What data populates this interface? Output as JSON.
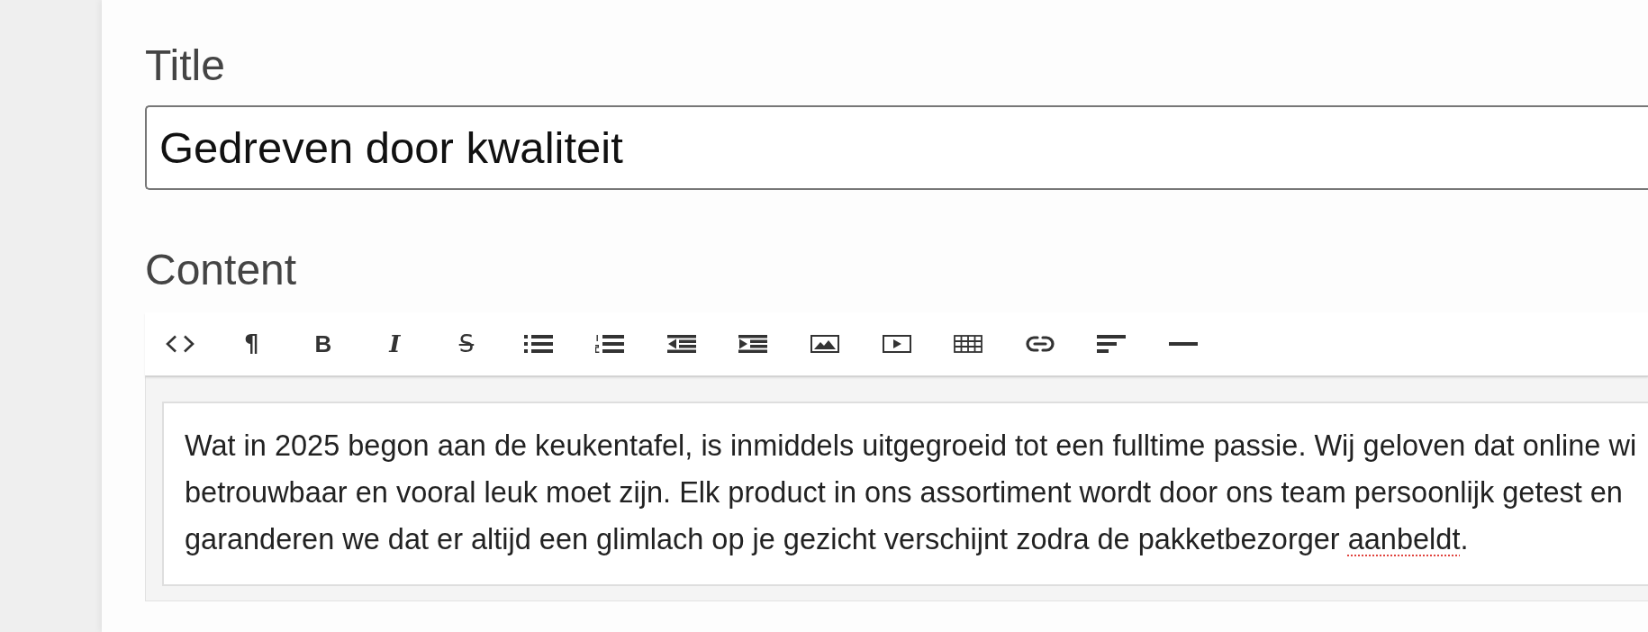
{
  "title_field": {
    "label": "Title",
    "value": "Gedreven door kwaliteit"
  },
  "content_editor": {
    "label": "Content",
    "toolbar": [
      {
        "kind": "source"
      },
      {
        "kind": "paragraph",
        "glyph": "¶"
      },
      {
        "kind": "bold",
        "glyph": "B"
      },
      {
        "kind": "italic",
        "glyph": "I"
      },
      {
        "kind": "strikethrough",
        "glyph": "S"
      },
      {
        "kind": "bullet-list"
      },
      {
        "kind": "numbered-list"
      },
      {
        "kind": "outdent"
      },
      {
        "kind": "indent"
      },
      {
        "kind": "image"
      },
      {
        "kind": "video"
      },
      {
        "kind": "table"
      },
      {
        "kind": "link"
      },
      {
        "kind": "align"
      },
      {
        "kind": "rule"
      }
    ],
    "lines": [
      [
        {
          "text": "Wat in 2025 begon aan de keukentafel, is inmiddels uitgegroeid tot een fulltime passie. Wij geloven dat online wi",
          "misspelled": false
        }
      ],
      [
        {
          "text": "betrouwbaar en vooral leuk moet zijn. Elk product in ons assortiment wordt door ons team persoonlijk getest en",
          "misspelled": false
        }
      ],
      [
        {
          "text": "garanderen we dat er altijd een glimlach op je gezicht verschijnt zodra de pakketbezorger ",
          "misspelled": false
        },
        {
          "text": "aanbeldt",
          "misspelled": true
        },
        {
          "text": ".",
          "misspelled": false
        }
      ]
    ]
  }
}
